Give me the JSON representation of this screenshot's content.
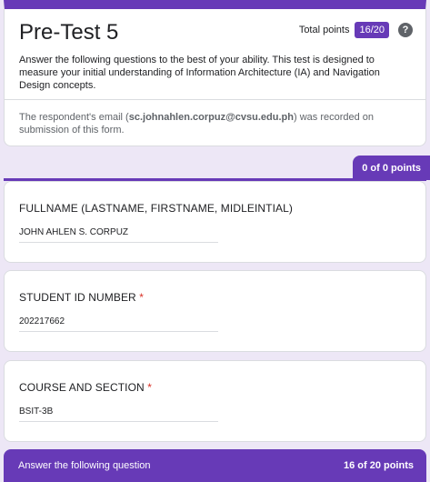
{
  "header": {
    "title": "Pre-Test 5",
    "total_points_label": "Total points",
    "total_points_value": "16/20",
    "help_icon": "help-icon",
    "description": "Answer the following questions to the best of your ability. This test is designed to measure your initial understanding of Information Architecture (IA) and Navigation Design concepts.",
    "email_note_prefix": "The respondent's email (",
    "email": "sc.johnahlen.corpuz@cvsu.edu.ph",
    "email_note_suffix": ") was recorded on submission of this form."
  },
  "section1": {
    "points": "0 of 0 points"
  },
  "questions": [
    {
      "label": "FULLNAME (LASTNAME, FIRSTNAME, MIDLEINTIAL)",
      "required": "",
      "answer": "JOHN AHLEN S. CORPUZ"
    },
    {
      "label": "STUDENT ID NUMBER",
      "required": "*",
      "answer": "202217662"
    },
    {
      "label": "COURSE AND SECTION",
      "required": "*",
      "answer": "BSIT-3B"
    }
  ],
  "section2": {
    "title": "Answer the following question",
    "points": "16 of 20 points"
  },
  "colors": {
    "accent": "#673ab7",
    "background": "#ede7f6",
    "required": "#d93025"
  }
}
